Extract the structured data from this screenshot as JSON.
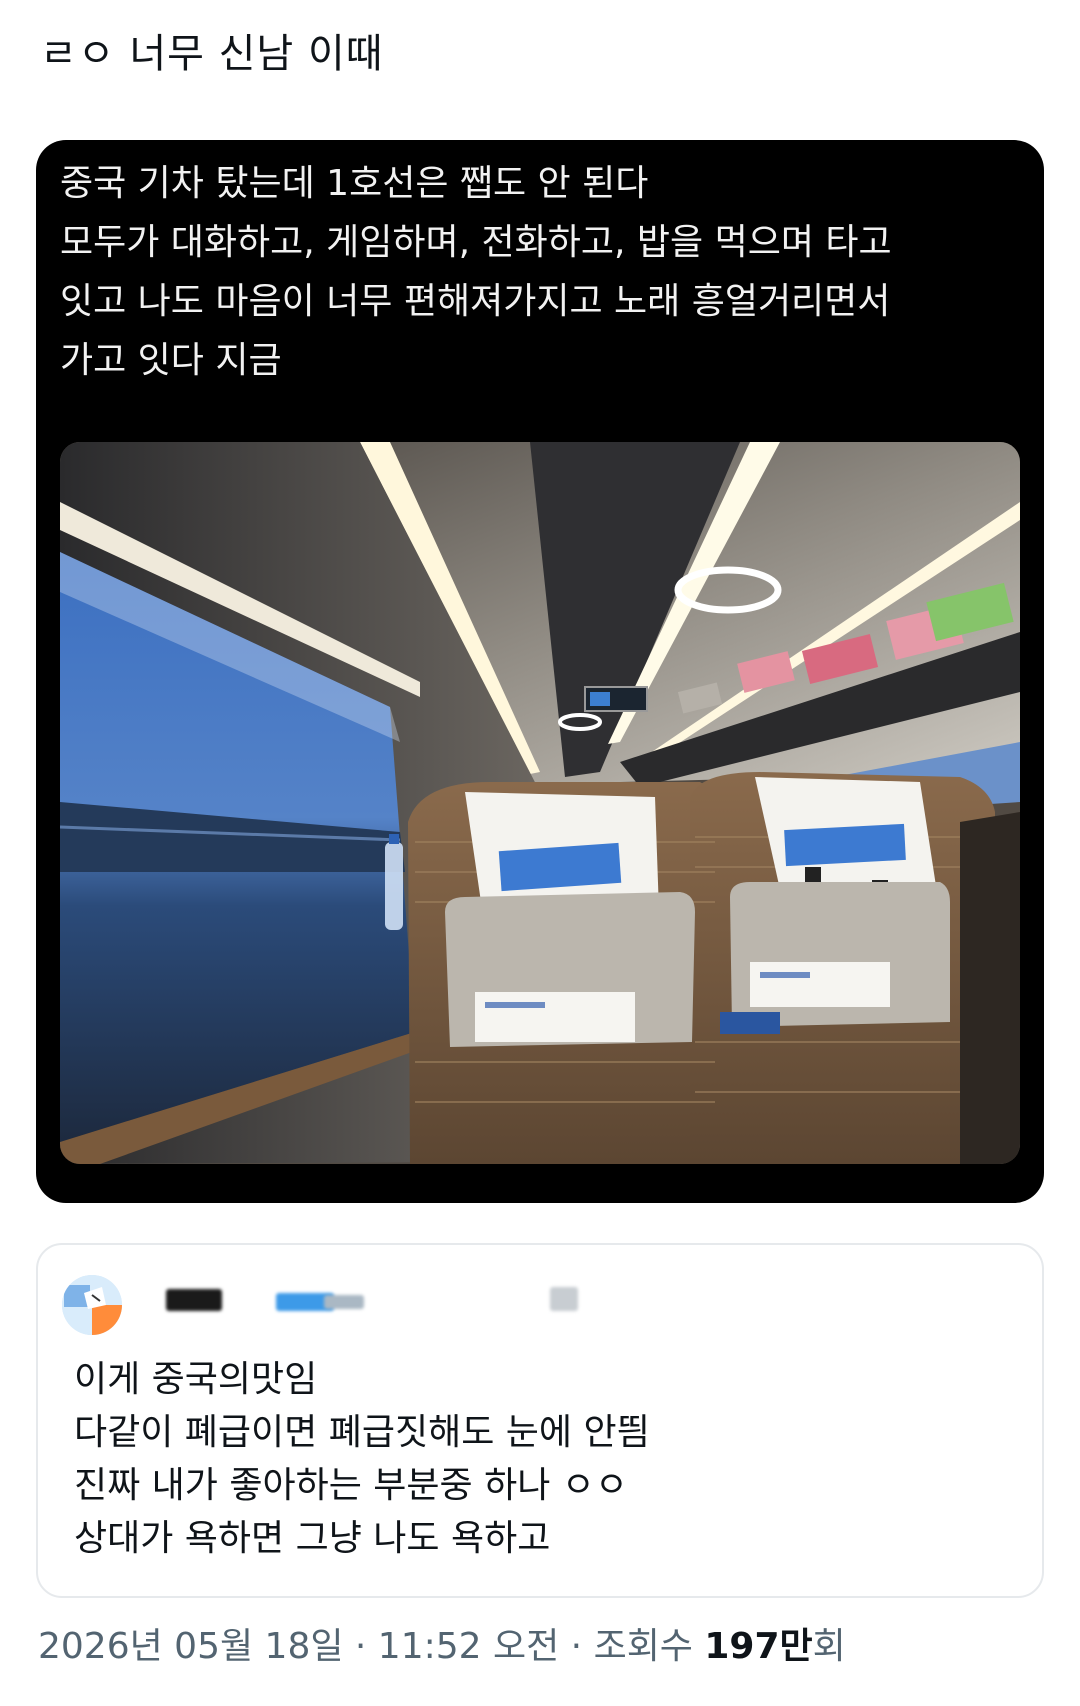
{
  "post": {
    "title": "ㄹㅇ 너무 신남 이때"
  },
  "media_card": {
    "lines": [
      "중국 기차 탔는데 1호선은 쨉도 안 된다",
      "모두가 대화하고, 게임하며, 전화하고, 밥을 먹으며 타고",
      "잇고 나도 마음이 너무 편해져가지고 노래 흥얼거리면서",
      "가고 잇다 지금"
    ]
  },
  "quote": {
    "lines": [
      "이게 중국의맛임",
      "다같이 폐급이면 폐급짓해도 눈에 안띔",
      "진짜 내가 좋아하는 부분중 하나 ㅇㅇ",
      "상대가 욕하면 그냥 나도 욕하고"
    ]
  },
  "meta": {
    "date_time": "2026년 05월 18일 · 11:52 오전 · 조회수 ",
    "views_count": "197만",
    "views_suffix": "회"
  },
  "colors": {
    "text_primary": "#0f1419",
    "text_secondary": "#536471",
    "card_bg": "#000000",
    "border": "#e6e9ec"
  }
}
